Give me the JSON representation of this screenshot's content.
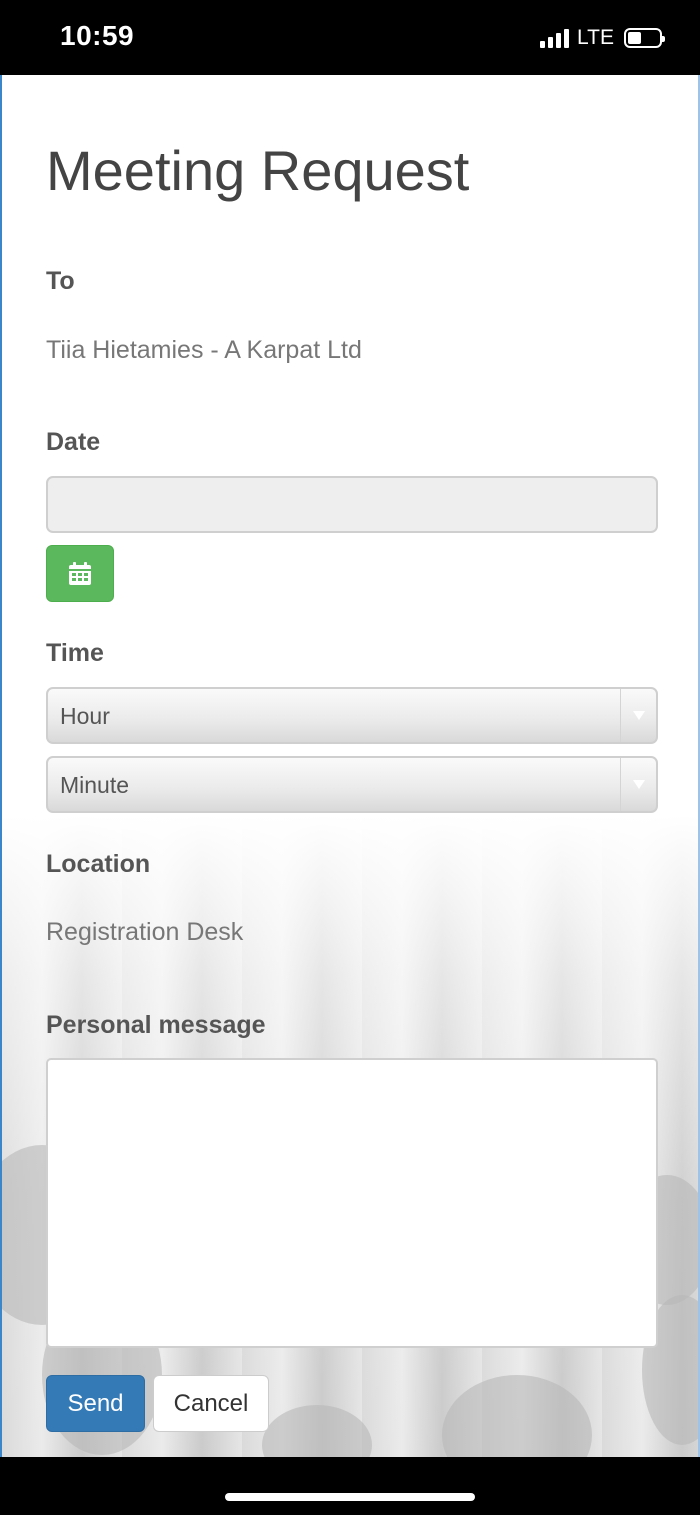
{
  "status_bar": {
    "time": "10:59",
    "network": "LTE",
    "battery_level": 0.35,
    "signal_bars": 4
  },
  "page": {
    "title": "Meeting Request"
  },
  "form": {
    "to_label": "To",
    "to_value": "Tiia Hietamies - A Karpat Ltd",
    "date_label": "Date",
    "date_value": "",
    "time_label": "Time",
    "hour_select": "Hour",
    "minute_select": "Minute",
    "location_label": "Location",
    "location_value": "Registration Desk",
    "message_label": "Personal message",
    "message_value": ""
  },
  "buttons": {
    "send": "Send",
    "cancel": "Cancel"
  },
  "icons": {
    "calendar": "calendar-icon",
    "dropdown": "chevron-down-icon"
  },
  "colors": {
    "send_button": "#337ab7",
    "calendar_button": "#5cb85c",
    "label_text": "#555555"
  }
}
